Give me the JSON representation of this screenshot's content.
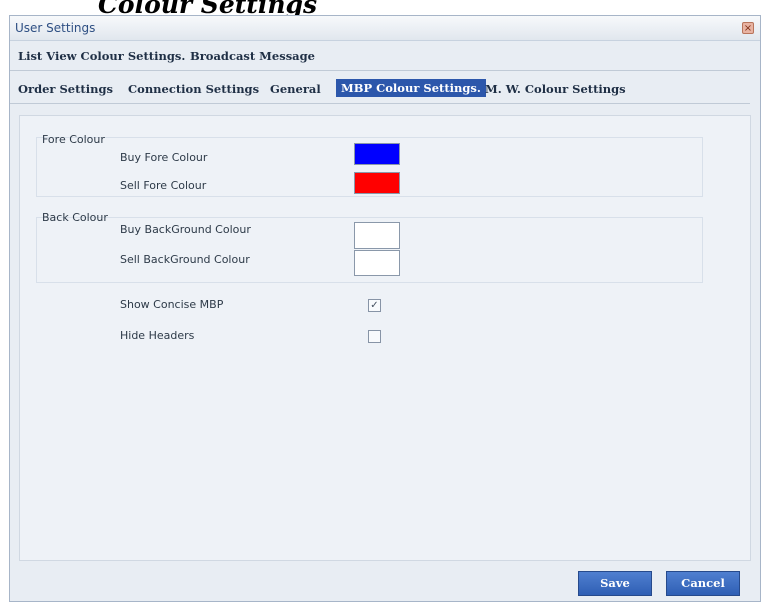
{
  "clipped_heading": "Colour Settings",
  "window": {
    "title": "User Settings",
    "close_glyph": "×"
  },
  "tabs_row1": [
    {
      "label": "List View Colour Settings."
    },
    {
      "label": "Broadcast Message"
    }
  ],
  "tabs_row2": [
    {
      "label": "Order Settings"
    },
    {
      "label": "Connection Settings"
    },
    {
      "label": "General"
    },
    {
      "label": "MBP Colour Settings.",
      "active": true
    },
    {
      "label": "M. W. Colour Settings"
    }
  ],
  "form": {
    "fore_group_label": "Fore Colour",
    "back_group_label": "Back Colour",
    "buy_fore_label": "Buy Fore  Colour",
    "sell_fore_label": "Sell Fore Colour",
    "buy_back_label": "Buy BackGround Colour",
    "sell_back_label": "Sell BackGround Colour",
    "buy_fore_color": "#0000ff",
    "sell_fore_color": "#ff0000",
    "buy_back_color": "#ffffff",
    "sell_back_color": "#ffffff",
    "show_concise_label": "Show Concise MBP",
    "show_concise_checked": true,
    "hide_headers_label": "Hide Headers",
    "hide_headers_checked": false,
    "check_glyph": "✓"
  },
  "footer": {
    "save_label": "Save",
    "cancel_label": "Cancel"
  }
}
